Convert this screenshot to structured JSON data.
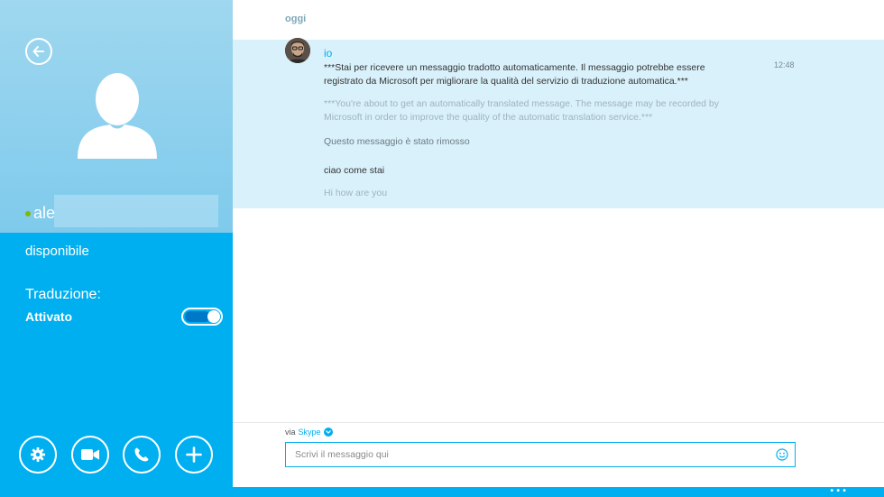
{
  "sidebar": {
    "contact_name": "ale",
    "status": "disponibile",
    "translation": {
      "label": "Traduzione:",
      "state": "Attivato",
      "enabled": true
    },
    "actions": [
      "gear-icon",
      "video-camera-icon",
      "phone-icon",
      "plus-icon"
    ],
    "colors": {
      "accent": "#00aff0",
      "presence": "#7fba00"
    }
  },
  "chat": {
    "date_header": "oggi",
    "sender": "io",
    "time": "12:48",
    "messages": [
      {
        "text": "***Stai per ricevere un messaggio tradotto automaticamente. Il messaggio potrebbe essere registrato da Microsoft per migliorare la qualità del servizio di traduzione automatica.***"
      },
      {
        "text": "***You're about to get an automatically translated message. The message may be recorded by Microsoft in order to improve the quality of the automatic translation service.***"
      },
      {
        "text": "Questo messaggio è stato rimosso"
      },
      {
        "text": "ciao come stai"
      },
      {
        "text": "Hi how are you"
      }
    ]
  },
  "compose": {
    "via_label": "via",
    "via_service": "Skype",
    "placeholder": "Scrivi il messaggio qui"
  },
  "bottom_bar": {
    "more_label": "•••"
  }
}
